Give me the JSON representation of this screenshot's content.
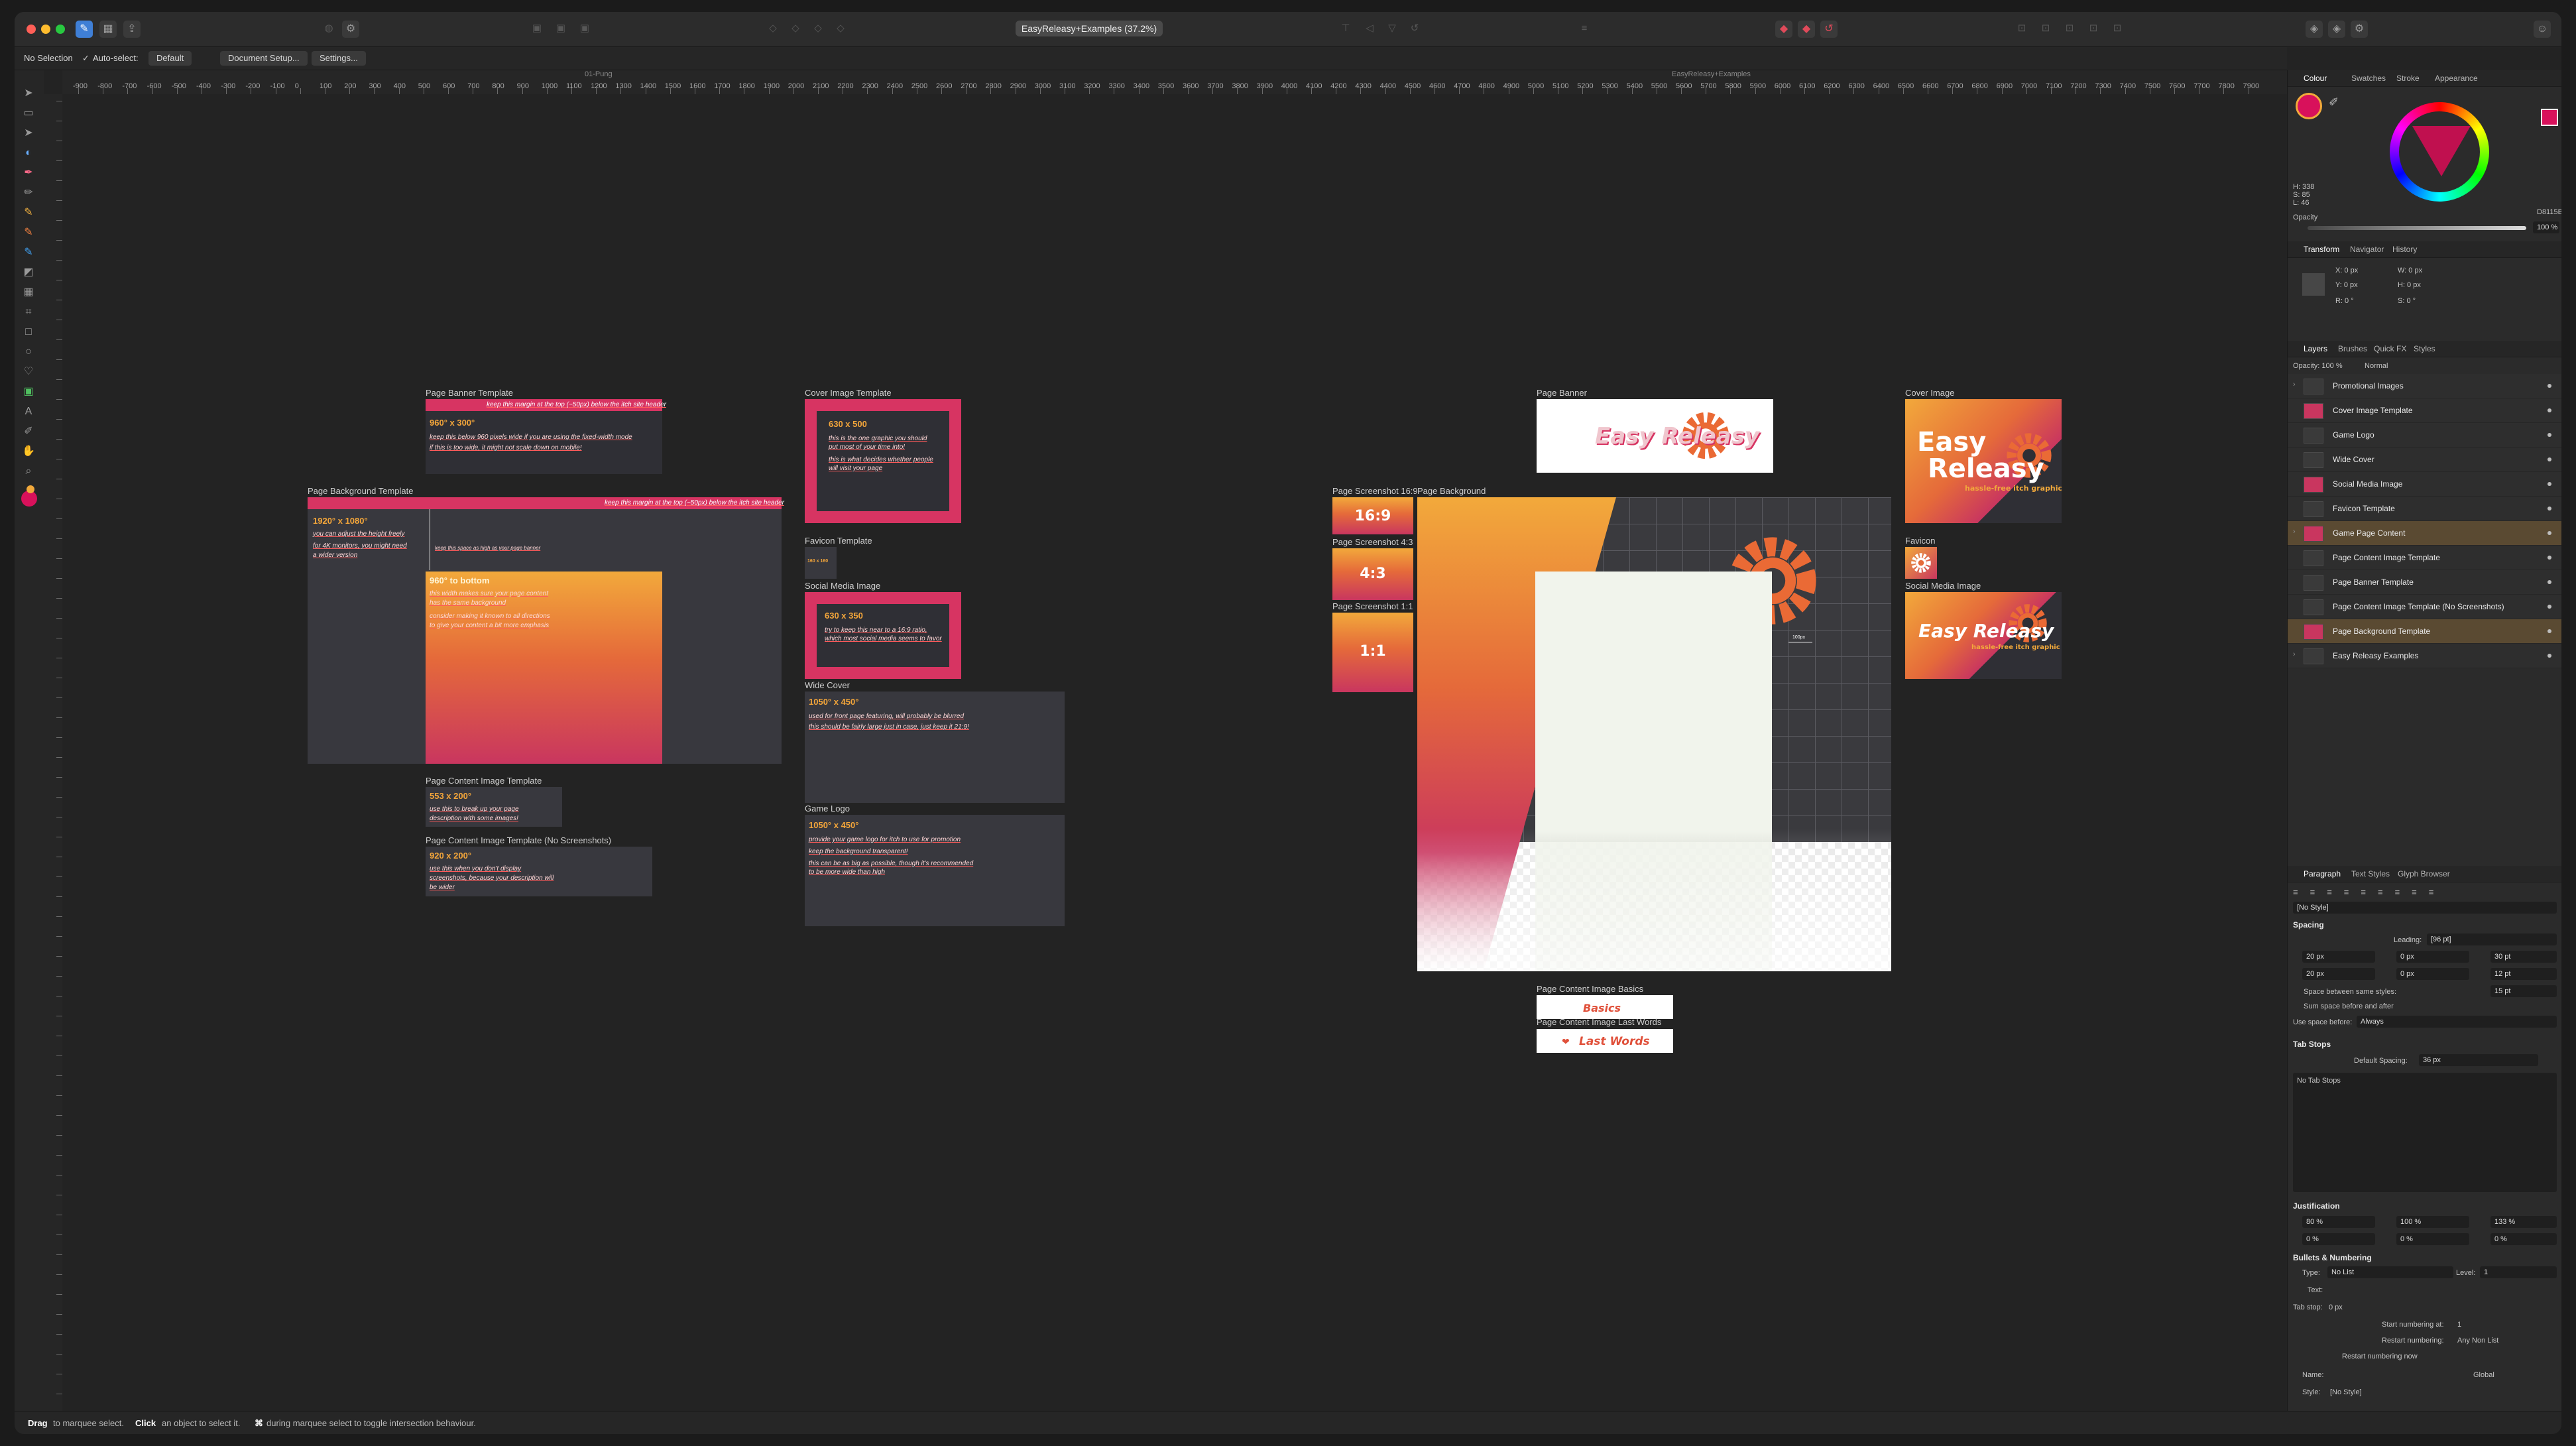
{
  "app": {
    "document_title": "EasyReleasy+Examples (37.2%)",
    "colors": {
      "accent": "#f04e5e",
      "brand_orange": "#f2a93b",
      "brand_pink": "#c9365f",
      "canvas_bg": "#232323"
    }
  },
  "context_toolbar": {
    "selection": "No Selection",
    "auto_select_label": "Auto-select:",
    "auto_select_value": "Default",
    "document_setup": "Document Setup...",
    "settings": "Settings..."
  },
  "ruler": {
    "labels": [
      "-900",
      "-800",
      "-700",
      "-600",
      "-500",
      "-400",
      "-300",
      "-200",
      "-100",
      "0",
      "100",
      "200",
      "300",
      "400",
      "500",
      "600",
      "700",
      "800",
      "900",
      "1000",
      "1100",
      "1200",
      "1300",
      "1400",
      "1500",
      "1600",
      "1700",
      "1800",
      "1900",
      "2000",
      "2100",
      "2200",
      "2300",
      "2400",
      "2500",
      "2600",
      "2700",
      "2800",
      "2900",
      "3000",
      "3100",
      "3200",
      "3300",
      "3400",
      "3500",
      "3600",
      "3700",
      "3800",
      "3900",
      "4000",
      "4100",
      "4200",
      "4300",
      "4400",
      "4500",
      "4600",
      "4700",
      "4800",
      "4900",
      "5000",
      "5100",
      "5200",
      "5300",
      "5400",
      "5500",
      "5600",
      "5700",
      "5800",
      "5900",
      "6000",
      "6100",
      "6200",
      "6300",
      "6400",
      "6500",
      "6600",
      "6700",
      "6800",
      "6900",
      "7000",
      "7100",
      "7200",
      "7300",
      "7400",
      "7500",
      "7600",
      "7700",
      "7800",
      "7900"
    ],
    "note_left": "01-Pung",
    "note_right": "EasyReleasy+Examples"
  },
  "artboards": {
    "page_banner_template": {
      "label": "Page Banner Template",
      "size": "960° x 300°",
      "note1": "keep this margin at the top (~50px) below the itch site header",
      "note2": "keep this below 960 pixels wide if you are using the fixed-width mode",
      "note3": "if this is too wide, it might not scale down on mobile!"
    },
    "page_background_template": {
      "label": "Page Background Template",
      "size": "1920° x 1080°",
      "note1": "keep this margin at the top (~50px) below the itch site header",
      "note2": "you can adjust the height freely",
      "note3": "for 4K monitors, you might need",
      "note4": "a wider version",
      "side_note": "keep this space as high as your page banner",
      "inner_size": "960° to bottom",
      "inner_note1": "this width makes sure your page content",
      "inner_note2": "has the same background",
      "inner_note3": "consider making it known to all directions",
      "inner_note4": "to give your content a bit more emphasis"
    },
    "page_content_image_template": {
      "label": "Page Content Image Template",
      "size": "553 x 200°",
      "note1": "use this to break up your page",
      "note2": "description with some images!"
    },
    "page_content_no_screenshots": {
      "label": "Page Content Image Template (No Screenshots)",
      "size": "920 x 200°",
      "note1": "use this when you don't display",
      "note2": "screenshots, because your description will",
      "note3": "be wider"
    },
    "cover_image_template": {
      "label": "Cover Image Template",
      "size": "630 x 500",
      "note1": "this is the one graphic you should",
      "note2": "put most of your time into!",
      "note3": "this is what decides whether people",
      "note4": "will visit your page"
    },
    "favicon_template": {
      "label": "Favicon Template",
      "size": "160 x 160"
    },
    "social_media_image": {
      "label": "Social Media Image",
      "size": "630 x 350",
      "note1": "try to keep this near to a 16:9 ratio,",
      "note2": "which most social media seems to favor"
    },
    "wide_cover": {
      "label": "Wide Cover",
      "size": "1050° x 450°",
      "note1": "used for front page featuring, will probably be blurred",
      "note2": "this should be fairly large just in case, just keep it 21:9!"
    },
    "game_logo": {
      "label": "Game Logo",
      "size": "1050° x 450°",
      "note1": "provide your game logo for itch to use for promotion",
      "note2": "keep the background transparent!",
      "note3": "this can be as big as possible, though it's recommended",
      "note4": "to be more wide than high"
    },
    "page_banner": {
      "label": "Page Banner",
      "logo": "Easy Releasy"
    },
    "cover_image": {
      "label": "Cover Image",
      "line1": "Easy",
      "line2": "Releasy",
      "tagline": "hassle-free itch graphic templates"
    },
    "favicon": {
      "label": "Favicon"
    },
    "social_media_image_example": {
      "label": "Social Media Image",
      "logo": "Easy Releasy",
      "tagline": "hassle-free itch graphic templates"
    },
    "screenshot_169": {
      "label": "Page Screenshot 16:9",
      "ratio": "16:9"
    },
    "screenshot_43": {
      "label": "Page Screenshot 4:3",
      "ratio": "4:3"
    },
    "screenshot_11": {
      "label": "Page Screenshot 1:1",
      "ratio": "1:1"
    },
    "page_background": {
      "label": "Page Background",
      "dim": "100px"
    },
    "page_content_basics": {
      "label": "Page Content Image Basics",
      "text": "Basics"
    },
    "page_content_last_words": {
      "label": "Page Content Image Last Words",
      "text": "Last Words"
    }
  },
  "status_bar": {
    "drag_bold": "Drag",
    "drag_rest": "to marquee select.",
    "click_bold": "Click",
    "click_rest": "an object to select it.",
    "alt_bold": "⌘",
    "alt_rest": "during marquee select to toggle intersection behaviour."
  },
  "panel": {
    "color_tabs": [
      "Colour",
      "Swatches",
      "Stroke",
      "Appearance"
    ],
    "hsl": {
      "h": "H: 338",
      "s": "S: 85",
      "l": "L: 46"
    },
    "hex": "D8115B",
    "opacity_label": "Opacity",
    "opacity_value": "100 %",
    "transform_tabs": [
      "Transform",
      "Navigator",
      "History"
    ],
    "transform": {
      "x": "X:  0 px",
      "y": "Y:  0 px",
      "w": "W:  0 px",
      "h": "H:  0 px",
      "r": "R:  0 °",
      "s": "S:  0 °"
    },
    "layers_tabs": [
      "Layers",
      "Brushes",
      "Quick FX",
      "Styles"
    ],
    "layers_opacity": "Opacity:  100 %",
    "layers_blend": "Normal",
    "layers": [
      "Promotional Images",
      "Cover Image Template",
      "Game Logo",
      "Wide Cover",
      "Social Media Image",
      "Favicon Template",
      "Game Page Content",
      "Page Content Image Template",
      "Page Banner Template",
      "Page Content Image Template (No Screenshots)",
      "Page Background Template",
      "Easy Releasy Examples"
    ],
    "paragraph_tabs": [
      "Paragraph",
      "Text Styles",
      "Glyph Browser"
    ],
    "style": "[No Style]",
    "spacing_title": "Spacing",
    "leading_label": "Leading:",
    "leading_value": "[96 pt]",
    "left_indent": "20 px",
    "first_indent": "0 px",
    "space_before": "30 pt",
    "right_indent": "20 px",
    "last_indent": "0 px",
    "space_after": "12 pt",
    "space_between_label": "Space between same styles:",
    "space_between_value": "15 pt",
    "sum_space_label": "Sum space before and after",
    "use_space_label": "Use space before:",
    "use_space_value": "Always",
    "tab_stops_title": "Tab Stops",
    "default_spacing_label": "Default Spacing:",
    "default_spacing_value": "36 px",
    "no_tab_stops": "No Tab Stops",
    "justification_title": "Justification",
    "just": [
      "80 %",
      "100 %",
      "133 %",
      "0 %",
      "0 %",
      "0 %"
    ],
    "bullets_title": "Bullets & Numbering",
    "type_label": "Type:",
    "type_value": "No List",
    "level_label": "Level:",
    "level_value": "1",
    "text_label": "Text:",
    "tab_stop_label": "Tab stop:",
    "tab_stop_value": "0 px",
    "start_numbering_label": "Start numbering at:",
    "start_numbering_value": "1",
    "restart_label": "Restart numbering:",
    "restart_value": "Any Non List",
    "restart_new_label": "Restart numbering now",
    "name_label": "Name:",
    "global_label": "Global",
    "style_label": "Style:",
    "style_value": "[No Style]"
  }
}
